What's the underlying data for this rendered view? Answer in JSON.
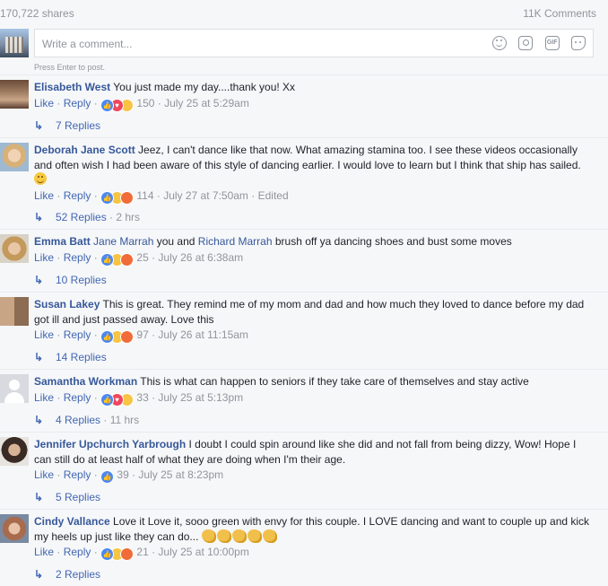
{
  "stats": {
    "shares": "170,722 shares",
    "comments": "11K Comments"
  },
  "composer": {
    "placeholder": "Write a comment...",
    "hint": "Press Enter to post.",
    "tools": [
      "emoji-icon",
      "camera-icon",
      "gif-icon",
      "sticker-icon"
    ]
  },
  "actions": {
    "like": "Like",
    "reply": "Reply",
    "sep": " · "
  },
  "comments": [
    {
      "author": "Elisabeth West",
      "text": "You just made my day....thank you! Xx",
      "reactions": [
        "like",
        "love",
        "wow"
      ],
      "reaction_count": "150",
      "time": "July 25 at 5:29am",
      "replies": "7 Replies"
    },
    {
      "author": "Deborah Jane Scott",
      "text": "Jeez, I can't dance like that now. What amazing stamina too. I see these videos occasionally and often wish I had been aware of this style of dancing earlier. I would love to learn but I think that ship has sailed.",
      "reactions": [
        "like",
        "sad",
        "angry"
      ],
      "reaction_count": "114",
      "time": "July 27 at 7:50am",
      "edited": "Edited",
      "replies": "52 Replies",
      "replies_ago": "2 hrs"
    },
    {
      "author": "Emma Batt",
      "tag1": "Jane Marrah",
      "mid": "you and",
      "tag2": "Richard Marrah",
      "text": "brush off ya dancing shoes and bust some moves",
      "reactions": [
        "like",
        "haha",
        "angry"
      ],
      "reaction_count": "25",
      "time": "July 26 at 6:38am",
      "replies": "10 Replies"
    },
    {
      "author": "Susan Lakey",
      "text": "This is great. They remind me of my mom and dad and how much they loved to dance before my dad got ill and just passed away. Love this",
      "reactions": [
        "like",
        "sad",
        "angry"
      ],
      "reaction_count": "97",
      "time": "July 26 at 11:15am",
      "replies": "14 Replies"
    },
    {
      "author": "Samantha Workman",
      "text": "This is what can happen to seniors if they take care of themselves and stay active",
      "reactions": [
        "like",
        "love",
        "sad"
      ],
      "reaction_count": "33",
      "time": "July 25 at 5:13pm",
      "replies": "4 Replies",
      "replies_ago": "11 hrs"
    },
    {
      "author": "Jennifer Upchurch Yarbrough",
      "text": "I doubt I could spin around like she did and not fall from being dizzy, Wow! Hope I can still do at least half of what they are doing when I'm their age.",
      "reactions": [
        "like"
      ],
      "reaction_count": "39",
      "time": "July 25 at 8:23pm",
      "replies": "5 Replies"
    },
    {
      "author": "Cindy Vallance",
      "text": "Love it Love it, sooo green with envy for this couple. I LOVE dancing and want to couple up and kick my heels up just like they can do...",
      "reactions": [
        "like",
        "wow",
        "angry"
      ],
      "reaction_count": "21",
      "time": "July 25 at 10:00pm",
      "replies": "2 Replies"
    }
  ]
}
